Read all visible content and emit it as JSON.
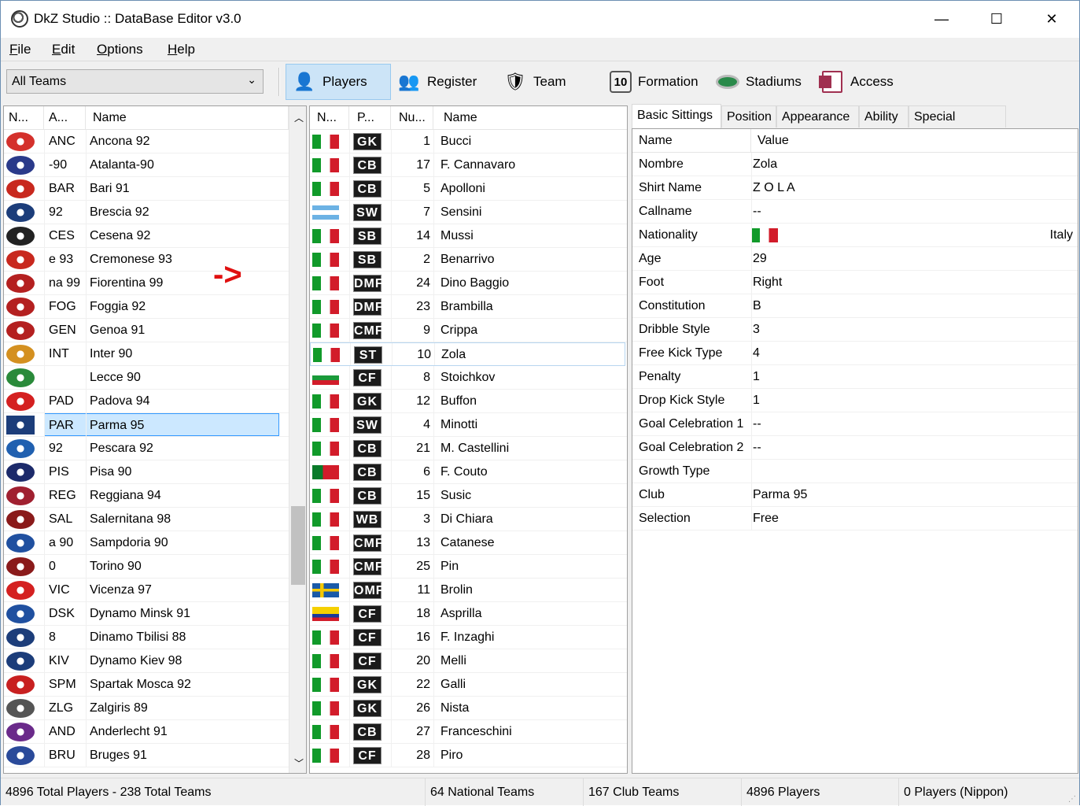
{
  "window": {
    "title": "DkZ Studio :: DataBase Editor v3.0",
    "min": "—",
    "max": "☐",
    "close": "✕"
  },
  "menu": [
    "File",
    "Edit",
    "Options",
    "Help"
  ],
  "toolbar": {
    "team_filter": "All Teams",
    "buttons": [
      "Players",
      "Register",
      "Team",
      "Formation",
      "Stadiums",
      "Access"
    ]
  },
  "teams": {
    "headers": [
      "N...",
      "A...",
      "Name"
    ],
    "rows": [
      {
        "abbr": "ANC",
        "name": "Ancona 92",
        "color": "#d4312c"
      },
      {
        "abbr": "-90",
        "name": "Atalanta-90",
        "color": "#2a3a8a"
      },
      {
        "abbr": "BAR",
        "name": "Bari 91",
        "color": "#c8281e"
      },
      {
        "abbr": "92",
        "name": "Brescia 92",
        "color": "#1c3d7a"
      },
      {
        "abbr": "CES",
        "name": "Cesena 92",
        "color": "#222222"
      },
      {
        "abbr": "e 93",
        "name": "Cremonese 93",
        "color": "#c8281e"
      },
      {
        "abbr": "na 99",
        "name": "Fiorentina 99",
        "color": "#b42020"
      },
      {
        "abbr": "FOG",
        "name": "Foggia 92",
        "color": "#b42020"
      },
      {
        "abbr": "GEN",
        "name": "Genoa 91",
        "color": "#b42020"
      },
      {
        "abbr": "INT",
        "name": "Inter 90",
        "color": "#d49020"
      },
      {
        "abbr": "",
        "name": "Lecce 90",
        "color": "#2a8a3a"
      },
      {
        "abbr": "PAD",
        "name": "Padova 94",
        "color": "#d42020"
      },
      {
        "abbr": "PAR",
        "name": "Parma 95",
        "color": "#1c3d7a"
      },
      {
        "abbr": "92",
        "name": "Pescara 92",
        "color": "#2060b0"
      },
      {
        "abbr": "PIS",
        "name": "Pisa 90",
        "color": "#1c2a6a"
      },
      {
        "abbr": "REG",
        "name": "Reggiana 94",
        "color": "#a02030"
      },
      {
        "abbr": "SAL",
        "name": "Salernitana 98",
        "color": "#8a1a1a"
      },
      {
        "abbr": "a 90",
        "name": "Sampdoria 90",
        "color": "#2050a0"
      },
      {
        "abbr": "0",
        "name": "Torino 90",
        "color": "#8a1a1a"
      },
      {
        "abbr": "VIC",
        "name": "Vicenza 97",
        "color": "#d42020"
      },
      {
        "abbr": "DSK",
        "name": "Dynamo Minsk 91",
        "color": "#2050a0"
      },
      {
        "abbr": "8",
        "name": "Dinamo Tbilisi 88",
        "color": "#1c3d7a"
      },
      {
        "abbr": "KIV",
        "name": "Dynamo Kiev 98",
        "color": "#1c3d7a"
      },
      {
        "abbr": "SPM",
        "name": "Spartak Mosca 92",
        "color": "#c82020"
      },
      {
        "abbr": "ZLG",
        "name": "Zalgiris 89",
        "color": "#555555"
      },
      {
        "abbr": "AND",
        "name": "Anderlecht 91",
        "color": "#6a2a8a"
      },
      {
        "abbr": "BRU",
        "name": "Bruges 91",
        "color": "#2a4a9a"
      }
    ]
  },
  "arrow": "->",
  "players": {
    "headers": [
      "N...",
      "P...",
      "Nu...",
      "Name"
    ],
    "rows": [
      {
        "flag": "ita",
        "pos": "GK",
        "num": "1",
        "name": "Bucci"
      },
      {
        "flag": "ita",
        "pos": "CB",
        "num": "17",
        "name": "F. Cannavaro"
      },
      {
        "flag": "ita",
        "pos": "CB",
        "num": "5",
        "name": "Apolloni"
      },
      {
        "flag": "arg",
        "pos": "SW",
        "num": "7",
        "name": "Sensini"
      },
      {
        "flag": "ita",
        "pos": "SB",
        "num": "14",
        "name": "Mussi"
      },
      {
        "flag": "ita",
        "pos": "SB",
        "num": "2",
        "name": "Benarrivo"
      },
      {
        "flag": "ita",
        "pos": "DMF",
        "num": "24",
        "name": "Dino Baggio"
      },
      {
        "flag": "ita",
        "pos": "DMF",
        "num": "23",
        "name": "Brambilla"
      },
      {
        "flag": "ita",
        "pos": "CMF",
        "num": "9",
        "name": "Crippa"
      },
      {
        "flag": "ita",
        "pos": "ST",
        "num": "10",
        "name": "Zola"
      },
      {
        "flag": "bul",
        "pos": "CF",
        "num": "8",
        "name": "Stoichkov"
      },
      {
        "flag": "ita",
        "pos": "GK",
        "num": "12",
        "name": "Buffon"
      },
      {
        "flag": "ita",
        "pos": "SW",
        "num": "4",
        "name": "Minotti"
      },
      {
        "flag": "ita",
        "pos": "CB",
        "num": "21",
        "name": "M. Castellini"
      },
      {
        "flag": "por",
        "pos": "CB",
        "num": "6",
        "name": "F. Couto"
      },
      {
        "flag": "ita",
        "pos": "CB",
        "num": "15",
        "name": "Susic"
      },
      {
        "flag": "ita",
        "pos": "WB",
        "num": "3",
        "name": "Di Chiara"
      },
      {
        "flag": "ita",
        "pos": "CMF",
        "num": "13",
        "name": "Catanese"
      },
      {
        "flag": "ita",
        "pos": "CMF",
        "num": "25",
        "name": "Pin"
      },
      {
        "flag": "swe",
        "pos": "OMF",
        "num": "11",
        "name": "Brolin"
      },
      {
        "flag": "col",
        "pos": "CF",
        "num": "18",
        "name": "Asprilla"
      },
      {
        "flag": "ita",
        "pos": "CF",
        "num": "16",
        "name": "F. Inzaghi"
      },
      {
        "flag": "ita",
        "pos": "CF",
        "num": "20",
        "name": "Melli"
      },
      {
        "flag": "ita",
        "pos": "GK",
        "num": "22",
        "name": "Galli"
      },
      {
        "flag": "ita",
        "pos": "GK",
        "num": "26",
        "name": "Nista"
      },
      {
        "flag": "ita",
        "pos": "CB",
        "num": "27",
        "name": "Franceschini"
      },
      {
        "flag": "ita",
        "pos": "CF",
        "num": "28",
        "name": "Piro"
      }
    ]
  },
  "tabs": [
    "Basic Sittings",
    "Position",
    "Appearance",
    "Ability",
    "Special Abilities"
  ],
  "details": {
    "headers": [
      "Name",
      "Value"
    ],
    "rows": [
      {
        "k": "Nombre",
        "v": "Zola"
      },
      {
        "k": "Shirt Name",
        "v": "Z O L A"
      },
      {
        "k": "Callname",
        "v": "--"
      },
      {
        "k": "Nationality",
        "v": "",
        "extra": "Italy"
      },
      {
        "k": "Age",
        "v": "29"
      },
      {
        "k": "Foot",
        "v": "Right"
      },
      {
        "k": "Constitution",
        "v": "B"
      },
      {
        "k": "Dribble Style",
        "v": "3"
      },
      {
        "k": "Free Kick Type",
        "v": "4"
      },
      {
        "k": "Penalty",
        "v": "1"
      },
      {
        "k": "Drop Kick Style",
        "v": "1"
      },
      {
        "k": "Goal Celebration 1",
        "v": "--"
      },
      {
        "k": "Goal Celebration 2",
        "v": "--"
      },
      {
        "k": "Growth Type",
        "v": ""
      },
      {
        "k": "Club",
        "v": "Parma 95"
      },
      {
        "k": "Selection",
        "v": "Free"
      }
    ]
  },
  "status": [
    "4896 Total Players  -  238 Total Teams",
    "64 National Teams",
    "167 Club Teams",
    "4896 Players",
    "0 Players (Nippon)"
  ]
}
